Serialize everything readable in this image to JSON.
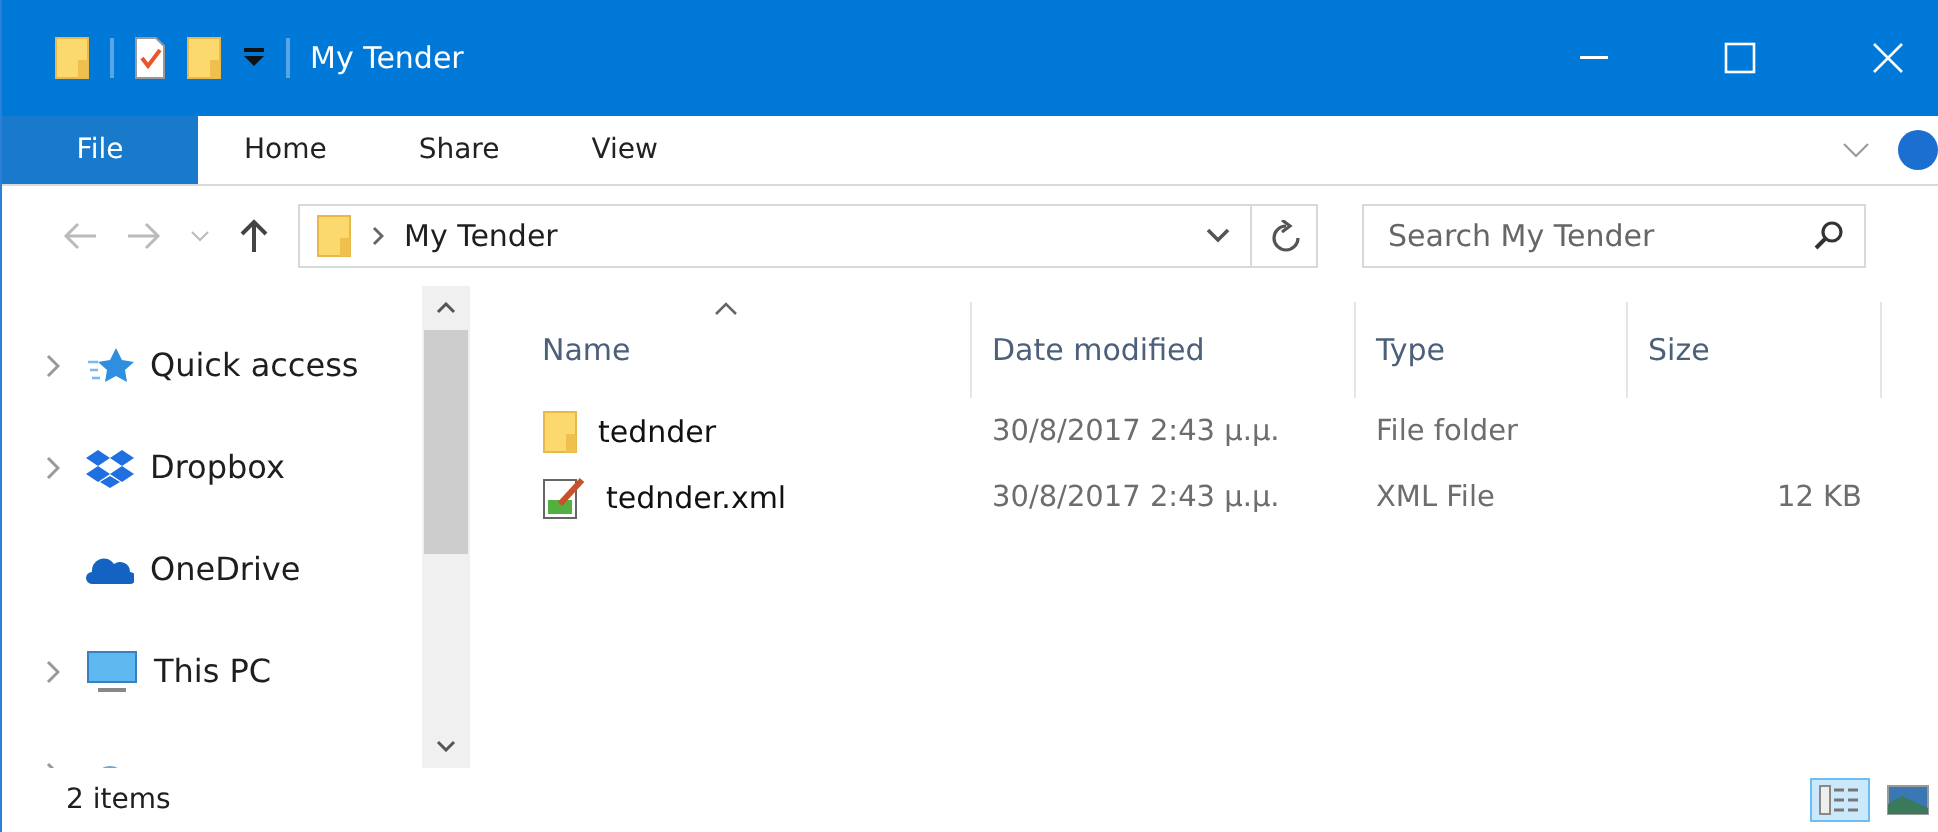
{
  "window": {
    "title": "My Tender"
  },
  "ribbon": {
    "file_tab": "File",
    "tabs": [
      "Home",
      "Share",
      "View"
    ]
  },
  "address_bar": {
    "path": [
      "My Tender"
    ]
  },
  "search": {
    "placeholder": "Search My Tender"
  },
  "navigation": [
    {
      "label": "Quick access",
      "kind": "quick",
      "expandable": true
    },
    {
      "label": "Dropbox",
      "kind": "dropbox",
      "expandable": true
    },
    {
      "label": "OneDrive",
      "kind": "onedrive",
      "expandable": false
    },
    {
      "label": "This PC",
      "kind": "pc",
      "expandable": true
    },
    {
      "kind": "network",
      "expandable": true
    }
  ],
  "table": {
    "columns": [
      "Name",
      "Date modified",
      "Type",
      "Size"
    ],
    "rows": [
      {
        "kind": "folder",
        "name": "tednder",
        "date": "30/8/2017 2:43 μ.μ.",
        "type": "File folder",
        "size": ""
      },
      {
        "kind": "xml",
        "name": "tednder.xml",
        "date": "30/8/2017 2:43 μ.μ.",
        "type": "XML File",
        "size": "12 KB"
      }
    ]
  },
  "status_bar": {
    "count": "2 items",
    "views": [
      {
        "kind": "details",
        "selected": true
      },
      {
        "kind": "large",
        "selected": false
      }
    ]
  }
}
